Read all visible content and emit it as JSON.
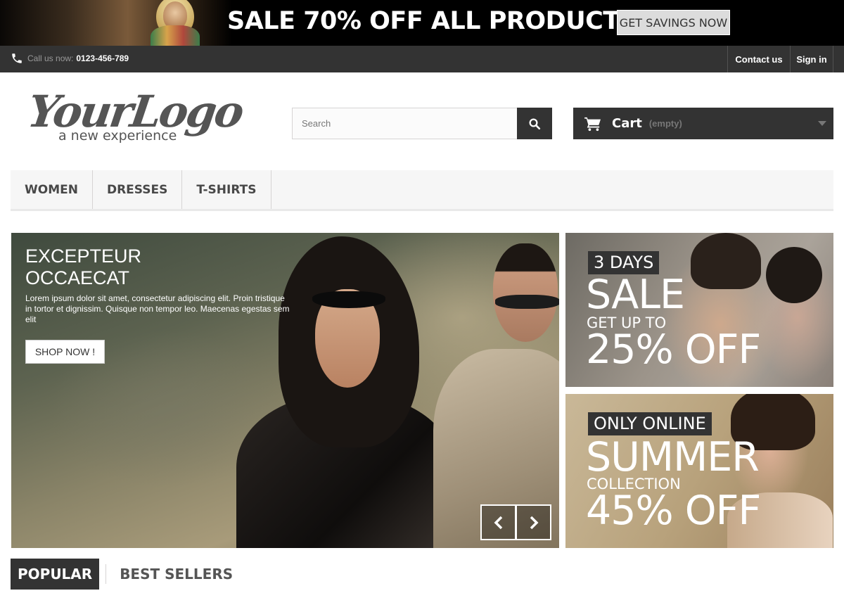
{
  "promo": {
    "text": "SALE 70% OFF ALL PRODUCTS",
    "button": "GET SAVINGS NOW"
  },
  "topbar": {
    "call_label": "Call us now:",
    "phone": "0123-456-789",
    "contact": "Contact us",
    "signin": "Sign in"
  },
  "logo": {
    "script": "YourLogo",
    "tagline": "a new experience"
  },
  "search": {
    "placeholder": "Search"
  },
  "cart": {
    "label": "Cart",
    "status": "(empty)"
  },
  "menu": {
    "items": [
      "WOMEN",
      "DRESSES",
      "T-SHIRTS"
    ]
  },
  "slider": {
    "title_line1": "EXCEPTEUR",
    "title_line2": "OCCAECAT",
    "text": "Lorem ipsum dolor sit amet, consectetur adipiscing elit. Proin tristique in tortor et dignissim. Quisque non tempor leo. Maecenas egestas sem elit",
    "button": "SHOP NOW !"
  },
  "banners": [
    {
      "tag": "3 DAYS",
      "big": "SALE",
      "small": "GET UP TO",
      "offer": "25% OFF"
    },
    {
      "tag": "ONLY ONLINE",
      "big": "SUMMER",
      "small": "COLLECTION",
      "offer": "45% OFF"
    }
  ],
  "tabs": {
    "popular": "POPULAR",
    "best_sellers": "BEST SELLERS"
  },
  "colors": {
    "dark": "#333333",
    "menu_bg": "#f6f6f6",
    "border": "#d6d4d4"
  }
}
